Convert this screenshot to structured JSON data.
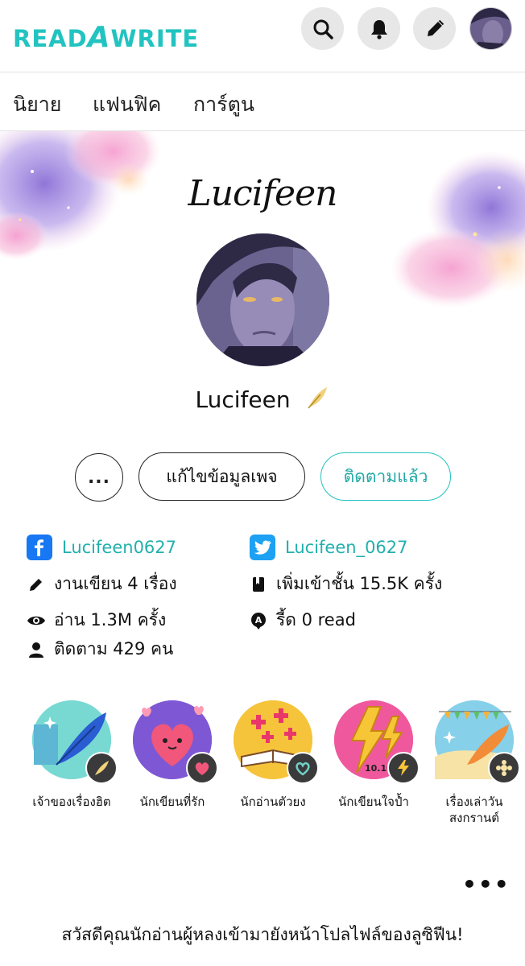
{
  "header": {
    "logo_text": "READAWRITE",
    "icons": [
      "search-icon",
      "bell-icon",
      "pencil-icon",
      "profile-avatar"
    ]
  },
  "tabs": [
    {
      "label": "นิยาย"
    },
    {
      "label": "แฟนฟิค"
    },
    {
      "label": "การ์ตูน"
    }
  ],
  "profile": {
    "signature": "Lucifeen",
    "name": "Lucifeen",
    "actions": {
      "more": "...",
      "edit": "แก้ไขข้อมูลเพจ",
      "follow": "ติดตามแล้ว"
    },
    "facebook": "Lucifeen0627",
    "twitter": "Lucifeen_0627",
    "stats": {
      "works": "งานเขียน 4 เรื่อง",
      "shelf": "เพิ่มเข้าชั้น 15.5K ครั้ง",
      "reads": "อ่าน 1.3M ครั้ง",
      "readi": "รี้ด 0 read",
      "followers": "ติดตาม 429 คน"
    }
  },
  "badges": [
    {
      "label": "เจ้าของเรื่องฮิต",
      "icon": "quill-icon"
    },
    {
      "label": "นักเขียนที่รัก",
      "icon": "heart-icon"
    },
    {
      "label": "นักอ่านตัวยง",
      "icon": "book-icon"
    },
    {
      "label": "นักเขียนใจป้ำ",
      "icon": "lightning-icon"
    },
    {
      "label": "เรื่องเล่าวัน สงกรานต์",
      "icon": "songkran-icon"
    }
  ],
  "badge_extra_text": "10.10",
  "greeting": "สวัสดีคุณนักอ่านผู้หลงเข้ามายังหน้าโปลไฟล์ของลูซิฟีน!",
  "colors": {
    "accent": "#22c3c0",
    "facebook": "#1877f2",
    "twitter": "#1da1f2"
  }
}
